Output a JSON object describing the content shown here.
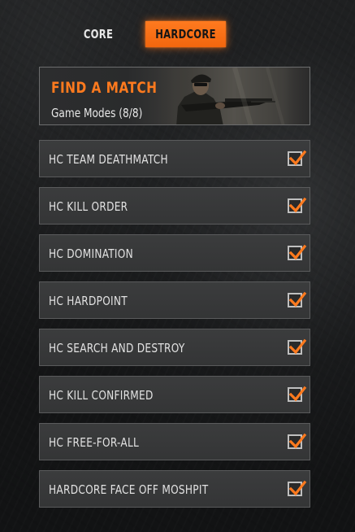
{
  "tabs": {
    "core_label": "CORE",
    "hardcore_label": "HARDCORE",
    "selected": "HARDCORE"
  },
  "find_match": {
    "title": "FIND A MATCH",
    "subtitle": "Game Modes (8/8)"
  },
  "modes": [
    {
      "label": "HC TEAM DEATHMATCH",
      "checked": true
    },
    {
      "label": "HC KILL ORDER",
      "checked": true
    },
    {
      "label": "HC DOMINATION",
      "checked": true
    },
    {
      "label": "HC HARDPOINT",
      "checked": true
    },
    {
      "label": "HC SEARCH AND DESTROY",
      "checked": true
    },
    {
      "label": "HC KILL CONFIRMED",
      "checked": true
    },
    {
      "label": "HC FREE-FOR-ALL",
      "checked": true
    },
    {
      "label": "HARDCORE FACE OFF MOSHPIT",
      "checked": true
    }
  ],
  "colors": {
    "accent": "#ff7a1e",
    "row_background": "#38393a",
    "row_border": "#5a5b5c",
    "text": "#e2e2e2"
  }
}
